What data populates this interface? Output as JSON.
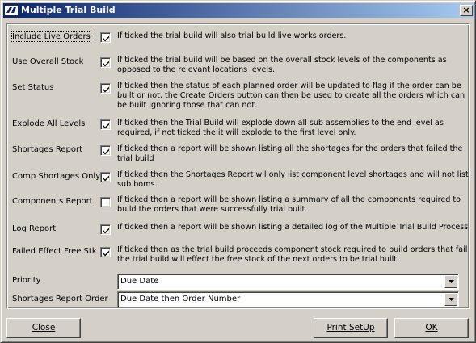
{
  "window": {
    "title": "Multiple Trial Build",
    "close_glyph": "×",
    "app_icon": "sp-logo-icon"
  },
  "options": [
    {
      "label": "Include Live Orders",
      "checked": true,
      "desc": "If ticked the trial build will also trial build live works orders."
    },
    {
      "label": "Use Overall Stock",
      "checked": true,
      "desc": "If ticked the trial build will be based on the overall stock levels of the components as opposed to the relevant locations levels."
    },
    {
      "label": "Set Status",
      "checked": true,
      "desc": "If ticked then the status of each planned order will be updated to flag if the order can be built or not, the Create Orders button can then be used to create all the orders which can be built ignoring those that can not."
    },
    {
      "label": "Explode All Levels",
      "checked": true,
      "desc": "If ticked then the Trial Build will explode down all sub assemblies to the end level as required, if not ticked the it will explode to the first level only."
    },
    {
      "label": "Shortages Report",
      "checked": true,
      "desc": "If ticked then a report will be shown listing all the shortages for the orders that failed the trial build"
    },
    {
      "label": "Comp Shortages Only",
      "checked": true,
      "desc": "If ticked then the Shortages Report wil only list component level shortages and will not list sub boms."
    },
    {
      "label": "Components Report",
      "checked": false,
      "desc": "If ticked then a report will be shown listing a summary of all the components required to build the orders that were successfully trial built"
    },
    {
      "label": "Log Report",
      "checked": true,
      "desc": "If ticked then a report will be shown listing a detailed log of the Multiple Trial Build Process"
    },
    {
      "label": "Failed Effect Free Stk",
      "checked": true,
      "desc": "If ticked then as the trial build proceeds component stock required to build orders that fail the trial build will effect the free stock of the next orders to be trial built."
    }
  ],
  "priority": {
    "label": "Priority",
    "value": "Due Date"
  },
  "shortages_order": {
    "label": "Shortages Report Order",
    "value": "Due Date then Order Number"
  },
  "buttons": {
    "close": "Close",
    "print_setup": "Print SetUp",
    "ok": "OK"
  }
}
